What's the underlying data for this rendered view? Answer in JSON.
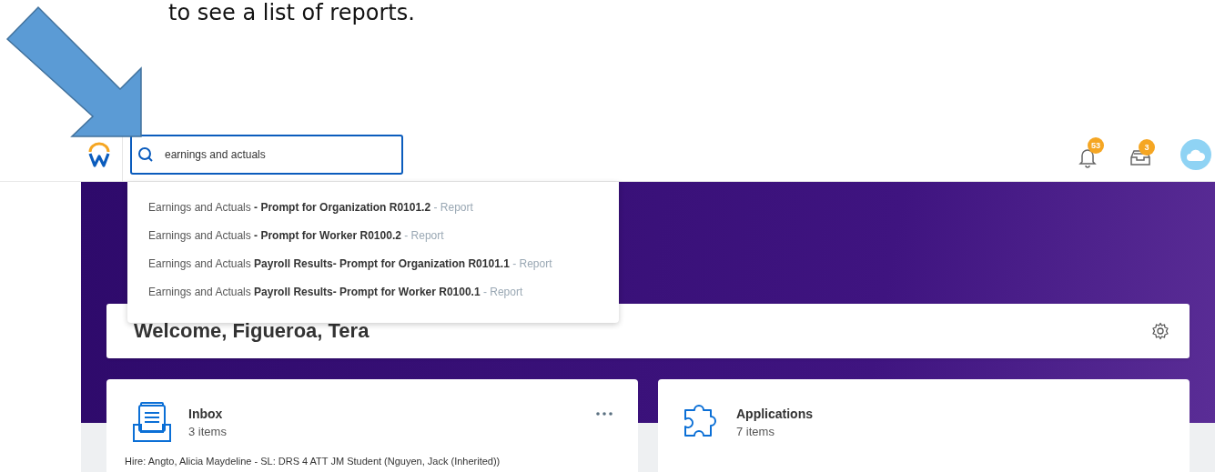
{
  "instruction_text": "to see a list of reports.",
  "search": {
    "value": "earnings and actuals"
  },
  "notifications": {
    "count": "53"
  },
  "inbox_badge": {
    "count": "3"
  },
  "suggestions": [
    {
      "text": "Earnings and Actuals **- Prompt for Organization R0101.2**",
      "type": "- Report"
    },
    {
      "text": "Earnings and Actuals **- Prompt for Worker R0100.2**",
      "type": "- Report"
    },
    {
      "text": "Earnings and Actuals **Payroll Results- Prompt for Organization R0101.1**",
      "type": "- Report"
    },
    {
      "text": "Earnings and Actuals **Payroll Results- Prompt for Worker R0100.1**",
      "type": "- Report"
    }
  ],
  "welcome": "Welcome, Figueroa, Tera",
  "cards": [
    {
      "kind": "inbox",
      "title": "Inbox",
      "count": "3 items",
      "line": "Hire: Angto, Alicia Maydeline - SL: DRS 4 ATT JM Student (Nguyen, Jack (Inherited))"
    },
    {
      "kind": "applications",
      "title": "Applications",
      "count": "7 items"
    }
  ]
}
